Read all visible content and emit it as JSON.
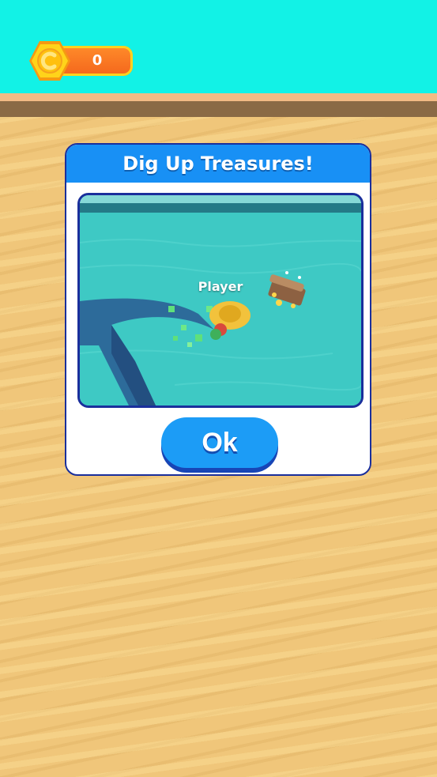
{
  "hud": {
    "coins": "0"
  },
  "tutorial": {
    "title": "Dig Up Treasures!",
    "player_label": "Player",
    "ok_label": "Ok"
  },
  "colors": {
    "sky": "#12f2e6",
    "sand": "#f0c67a",
    "header": "#1890f5",
    "button": "#1c9cf6",
    "border": "#1a2f9c",
    "coin_bar": "#f4661c",
    "coin": "#ffcf1f"
  },
  "icons": {
    "coin": "coin-icon",
    "treasure": "treasure-chest-icon",
    "player": "player-hat-icon"
  }
}
